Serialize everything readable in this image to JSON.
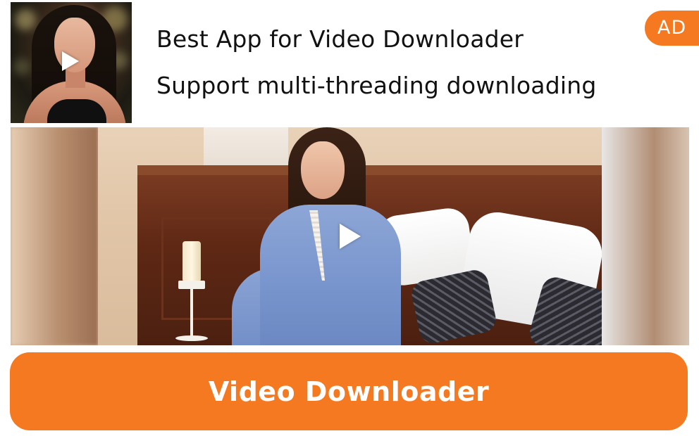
{
  "ad": {
    "headline": "Best App for Video Downloader",
    "subline": "Support multi-threading downloading",
    "badge": "AD",
    "cta_label": "Video Downloader",
    "accent_color": "#f47920",
    "icons": {
      "thumbnail_play": "play-icon",
      "media_play": "play-icon"
    }
  }
}
